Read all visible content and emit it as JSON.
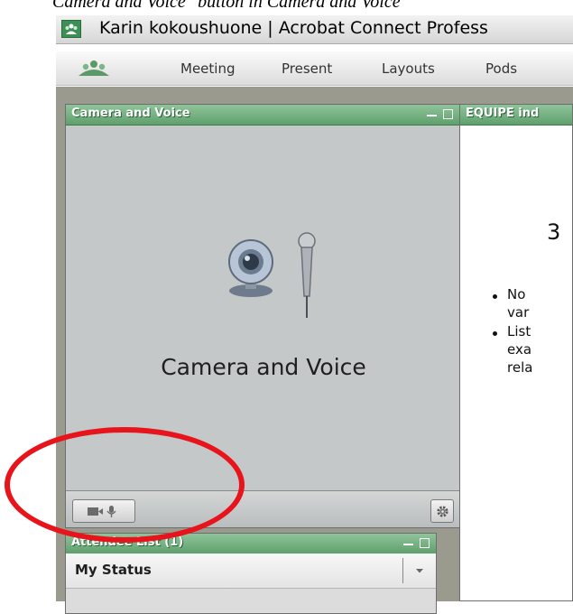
{
  "caption": "Camera and Voice\" button in Camera and Voice",
  "window": {
    "title": "Karin kokoushuone | Acrobat Connect Profess"
  },
  "menu": {
    "items": [
      "Meeting",
      "Present",
      "Layouts",
      "Pods"
    ]
  },
  "camera_pod": {
    "title": "Camera and Voice",
    "label": "Camera and Voice"
  },
  "content_pod": {
    "title": "EQUIPE ind",
    "heading_digit": "3",
    "bullets": [
      [
        "No",
        "var"
      ],
      [
        "List",
        "exa",
        "rela"
      ]
    ]
  },
  "attendee_pod": {
    "title": "Attendee List (1)",
    "status_label": "My Status"
  },
  "icons": {
    "app": "acrobat-connect-logo-icon",
    "webcam": "webcam-icon",
    "microphone": "microphone-icon",
    "gear": "gear-icon",
    "dropdown": "chevron-down-icon"
  },
  "colors": {
    "pod_header": "#6fab7c",
    "highlight_ellipse": "#e8141b"
  }
}
